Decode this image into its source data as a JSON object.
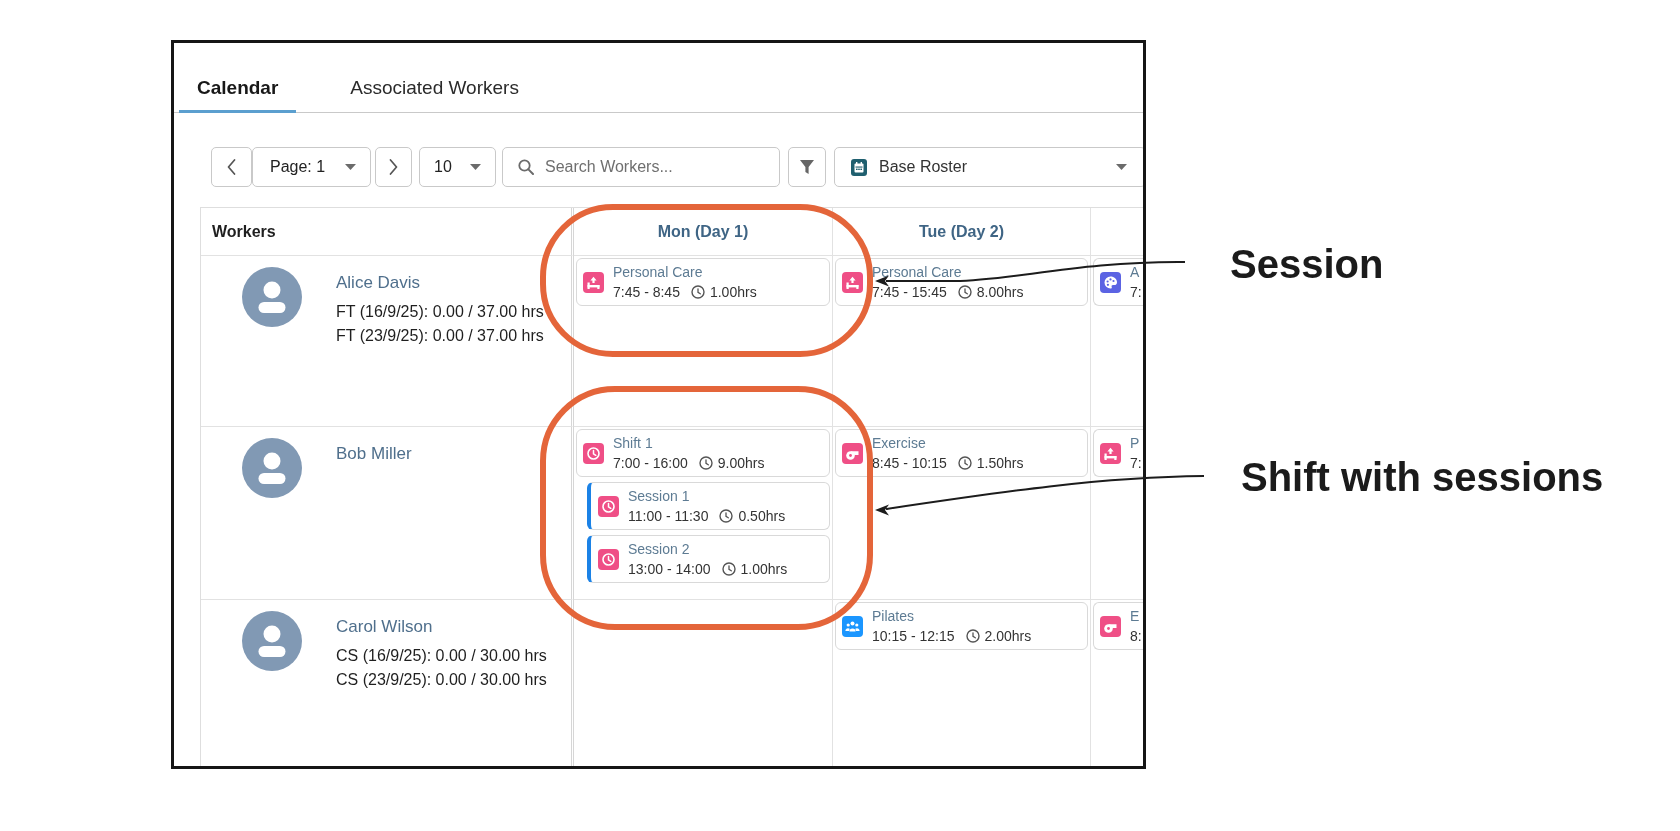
{
  "tabs": [
    {
      "label": "Calendar",
      "selected": true
    },
    {
      "label": "Associated Workers",
      "selected": false
    }
  ],
  "toolbar": {
    "page_select": "Page: 1",
    "page_size": "10",
    "search": {
      "placeholder": "Search Workers..."
    },
    "roster_select": "Base Roster"
  },
  "grid": {
    "workers_heading": "Workers",
    "day_headings": [
      "Mon (Day 1)",
      "Tue (Day 2)"
    ],
    "rows": [
      {
        "name": "Alice Davis",
        "hours": [
          "FT (16/9/25): 0.00 / 37.00 hrs",
          "FT (23/9/25): 0.00 / 37.00 hrs"
        ],
        "day_1": [
          {
            "kind": "care",
            "color": "#ef4f86",
            "title": "Personal Care",
            "time": "7:45 - 8:45",
            "duration": "1.00hrs"
          }
        ],
        "day_2": [
          {
            "kind": "care",
            "color": "#ef4f86",
            "title": "Personal Care",
            "time": "7:45 - 15:45",
            "duration": "8.00hrs"
          }
        ],
        "day_3": [
          {
            "kind": "art",
            "color": "#5b63e3",
            "title": "A",
            "time": "7:"
          }
        ]
      },
      {
        "name": "Bob Miller",
        "day_1": [
          {
            "kind": "shift",
            "color": "#ef4f86",
            "title": "Shift 1",
            "time": "7:00 - 16:00",
            "duration": "9.00hrs",
            "sessions": [
              {
                "kind": "session",
                "color": "#ef4f86",
                "title": "Session 1",
                "time": "11:00 - 11:30",
                "duration": "0.50hrs"
              },
              {
                "kind": "session",
                "color": "#ef4f86",
                "title": "Session 2",
                "time": "13:00 - 14:00",
                "duration": "1.00hrs"
              }
            ]
          }
        ],
        "day_2": [
          {
            "kind": "exercise",
            "color": "#ef4f86",
            "title": "Exercise",
            "time": "8:45 - 10:15",
            "duration": "1.50hrs"
          }
        ],
        "day_3": [
          {
            "kind": "care",
            "color": "#ef4f86",
            "title": "P",
            "time": "7:"
          }
        ]
      },
      {
        "name": "Carol Wilson",
        "hours": [
          "CS (16/9/25): 0.00 / 30.00 hrs",
          "CS (23/9/25): 0.00 / 30.00 hrs"
        ],
        "day_2": [
          {
            "kind": "group",
            "color": "#1b96ff",
            "title": "Pilates",
            "time": "10:15 - 12:15",
            "duration": "2.00hrs"
          }
        ],
        "day_3": [
          {
            "kind": "exercise",
            "color": "#ef4f86",
            "title": "E",
            "time": "8:"
          }
        ]
      }
    ]
  },
  "annotations": [
    {
      "label": "Session"
    },
    {
      "label": "Shift with sessions"
    }
  ]
}
